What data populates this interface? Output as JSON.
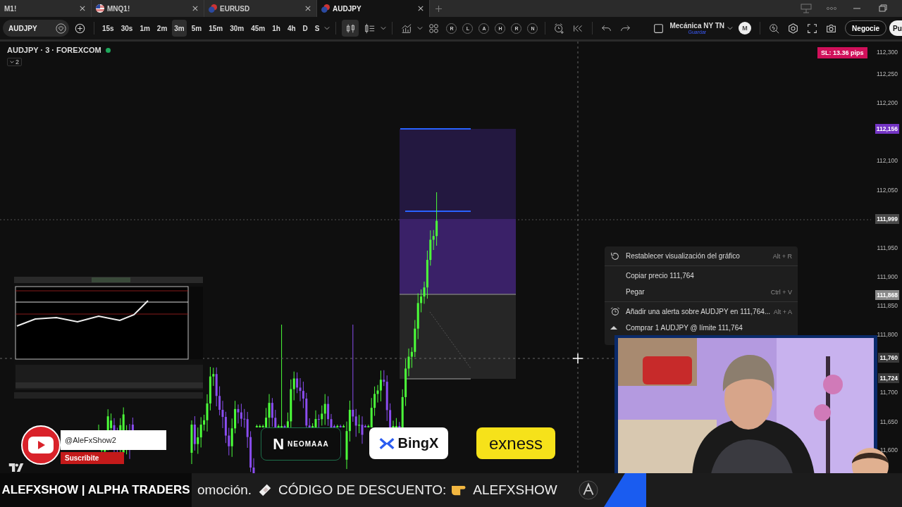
{
  "tabs": [
    {
      "label": "M1!",
      "selected": false,
      "kind": "plain"
    },
    {
      "label": "MNQ1!",
      "selected": false,
      "kind": "flag"
    },
    {
      "label": "EURUSD",
      "selected": false,
      "kind": "pair"
    },
    {
      "label": "AUDJPY",
      "selected": true,
      "kind": "pair"
    }
  ],
  "toolbar": {
    "symbol": "AUDJPY",
    "intervals": [
      {
        "label": "15s",
        "selected": false
      },
      {
        "label": "30s",
        "selected": false
      },
      {
        "label": "1m",
        "selected": false
      },
      {
        "label": "2m",
        "selected": false
      },
      {
        "label": "3m",
        "selected": true
      },
      {
        "label": "5m",
        "selected": false
      },
      {
        "label": "15m",
        "selected": false
      },
      {
        "label": "30m",
        "selected": false
      },
      {
        "label": "45m",
        "selected": false
      },
      {
        "label": "1h",
        "selected": false
      },
      {
        "label": "4h",
        "selected": false
      },
      {
        "label": "D",
        "selected": false
      },
      {
        "label": "S",
        "selected": false
      }
    ],
    "tool_letters": [
      "R",
      "L",
      "A",
      "H",
      "R",
      "N"
    ],
    "layout_name": "Mecánica NY TN",
    "layout_status": "Guardar",
    "account_letter": "M",
    "trade_button": "Negocie",
    "cut_button": "Pu"
  },
  "legend": {
    "title": "AUDJPY · 3 · FOREXCOM",
    "connected": true,
    "indicator_count": "2"
  },
  "sl_label": "SL: 13.36 pips",
  "price_axis": [
    {
      "label": "112,300",
      "kind": "tick"
    },
    {
      "label": "112,250",
      "kind": "tick"
    },
    {
      "label": "112,200",
      "kind": "tick"
    },
    {
      "label": "112,156",
      "kind": "marker",
      "color": "#7434c4"
    },
    {
      "label": "112,100",
      "kind": "tick"
    },
    {
      "label": "112,050",
      "kind": "tick"
    },
    {
      "label": "111,999",
      "kind": "marker",
      "color": "#4a4a4a"
    },
    {
      "label": "111,950",
      "kind": "tick"
    },
    {
      "label": "111,900",
      "kind": "tick"
    },
    {
      "label": "111,868",
      "kind": "marker",
      "color": "#8a8a8a"
    },
    {
      "label": "111,850",
      "kind": "tick"
    },
    {
      "label": "111,800",
      "kind": "tick"
    },
    {
      "label": "11,760",
      "kind": "marker",
      "color": "#3a3a3a"
    },
    {
      "label": "11,724",
      "kind": "marker",
      "color": "#3a3a3a"
    },
    {
      "label": "11,700",
      "kind": "tick"
    },
    {
      "label": "11,650",
      "kind": "tick"
    },
    {
      "label": "11,600",
      "kind": "tick"
    }
  ],
  "context_menu": [
    {
      "label": "Restablecer visualización del gráfico",
      "shortcut": "Alt + R",
      "kind": "reset",
      "divider_after": true
    },
    {
      "label": "Copiar precio 111,764",
      "kind": "plain",
      "divider_after": false
    },
    {
      "label": "Pegar",
      "shortcut": "Ctrl + V",
      "kind": "plain",
      "divider_after": true
    },
    {
      "label": "Añadir una alerta sobre AUDJPY en 111,764...",
      "shortcut": "Alt + A",
      "kind": "alert",
      "divider_after": false
    },
    {
      "label": "Comprar 1 AUDJPY @ límite 111,764",
      "kind": "buy",
      "divider_after": false
    }
  ],
  "youtube": {
    "handle": "@AleFxShow2",
    "subscribe": "Suscribite"
  },
  "sponsors": [
    {
      "kind": "neomaaa",
      "mark": "N",
      "label": "NEOMAAA"
    },
    {
      "kind": "bingx",
      "label": "BingX"
    },
    {
      "kind": "exness",
      "label": "exness"
    }
  ],
  "ticker": {
    "brand": "ALEFXSHOW | ALPHA TRADERS",
    "segments": [
      "omoción.",
      "CÓDIGO DE DESCUENTO:",
      "ALEFXSHOW"
    ]
  }
}
